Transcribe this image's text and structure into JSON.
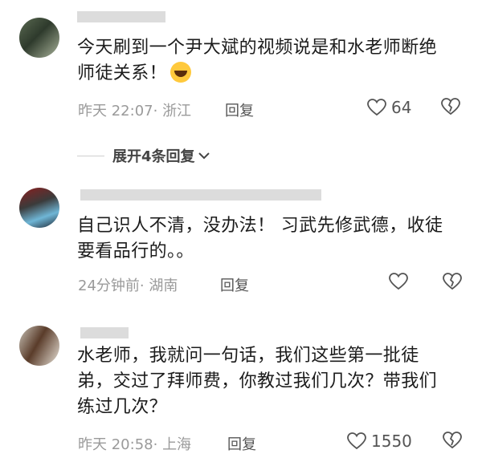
{
  "comments": [
    {
      "text": "今天刷到一个尹大斌的视频说是和水老师断绝师徒关系！",
      "time": "昨天 22:07",
      "region": "浙江",
      "reply_label": "回复",
      "likes": "64",
      "expand_label": "展开4条回复",
      "emoji_icon": "laughing-tears-icon"
    },
    {
      "text": "自己识人不清，没办法！ 习武先修武德，收徒要看品行的。。",
      "time": "24分钟前",
      "region": "湖南",
      "reply_label": "回复",
      "likes": ""
    },
    {
      "text": "水老师，我就问一句话，我们这些第一批徒弟，交过了拜师费，你教过我们几次？带我们练过几次？",
      "time": "昨天 20:58",
      "region": "上海",
      "reply_label": "回复",
      "likes": "1550"
    }
  ],
  "icons": {
    "like": "heart-outline-icon",
    "dislike": "broken-heart-icon",
    "expand": "chevron-down-icon"
  }
}
